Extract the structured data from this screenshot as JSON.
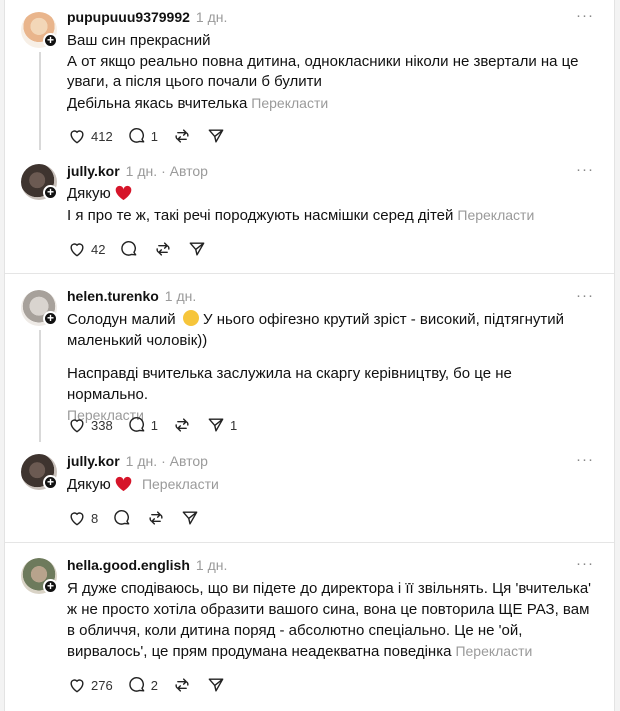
{
  "comments": [
    {
      "username": "pupupuuu9379992",
      "time": "1 дн.",
      "lines": [
        "Ваш син прекрасний",
        "А от якщо реально повна дитина, однокласники ніколи не звертали на це уваги, а після цього почали б булити",
        "Дебільна якась вчителька"
      ],
      "translate": "Перекласти",
      "likes": "412",
      "replies": "1",
      "reposts": "",
      "shares": ""
    },
    {
      "username": "jully.kor",
      "time": "1 дн.",
      "author_badge": "· Автор",
      "lines": [
        "Дякую",
        "І я про те ж, такі речі породжують насмішки серед дітей"
      ],
      "translate": "Перекласти",
      "likes": "42",
      "replies": "",
      "reposts": "",
      "shares": ""
    },
    {
      "username": "helen.turenko",
      "time": "1 дн.",
      "lines": [
        "Солодун малий",
        "У нього офігезно крутий зріст - високий, підтягнутий маленький чоловік))",
        "Насправді вчителька заслужила на скаргу керівництву, бо це не нормально."
      ],
      "translate": "Перекласти",
      "likes": "338",
      "replies": "1",
      "reposts": "",
      "shares": "1"
    },
    {
      "username": "jully.kor",
      "time": "1 дн.",
      "author_badge": "· Автор",
      "lines": [
        "Дякую"
      ],
      "translate": "Перекласти",
      "likes": "8",
      "replies": "",
      "reposts": "",
      "shares": ""
    },
    {
      "username": "hella.good.english",
      "time": "1 дн.",
      "lines": [
        "Я дуже сподіваюсь, що ви підете до директора і її звільнять. Ця 'вчителька' ж не просто хотіла образити вашого сина, вона це повторила ЩЕ РАЗ, вам в обличчя, коли дитина поряд - абсолютно спеціально. Це не 'ой, вирвалось', це прям продумана неадекватна поведінка"
      ],
      "translate": "Перекласти",
      "likes": "276",
      "replies": "2",
      "reposts": "",
      "shares": ""
    }
  ],
  "more_menu": "···",
  "colors": {
    "heart": "#d6152a",
    "muted": "#9a9a9a",
    "text": "#111111"
  }
}
